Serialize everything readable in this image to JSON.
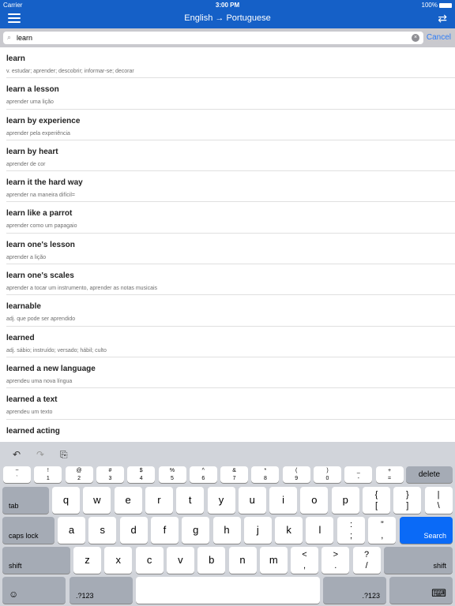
{
  "status_bar": {
    "carrier": "Carrier",
    "time": "3:00 PM",
    "battery": "100%"
  },
  "nav": {
    "title": "English → Portuguese",
    "menu_icon": "hamburger-icon",
    "swap_icon": "swap-arrows-icon",
    "swap_glyph": "⇄"
  },
  "search": {
    "value": "learn",
    "placeholder": "",
    "clear_glyph": "×",
    "search_glyph": "⌕",
    "cancel_label": "Cancel"
  },
  "results": [
    {
      "term": "learn",
      "translation": "v. estudar; aprender; descobrir; informar-se; decorar"
    },
    {
      "term": "learn a lesson",
      "translation": "aprender uma lição"
    },
    {
      "term": "learn by experience",
      "translation": "aprender pela experiência"
    },
    {
      "term": "learn by heart",
      "translation": "aprender de cor"
    },
    {
      "term": "learn it the hard way",
      "translation": "aprender na maneira difícil="
    },
    {
      "term": "learn like a parrot",
      "translation": "aprender como um papagaio"
    },
    {
      "term": "learn one's lesson",
      "translation": "aprender a lição"
    },
    {
      "term": "learn one's scales",
      "translation": "aprender a tocar um instrumento, aprender as notas musicais"
    },
    {
      "term": "learnable",
      "translation": "adj. que pode ser aprendido"
    },
    {
      "term": "learned",
      "translation": "adj. sábio; instruído; versado; hábil; culto"
    },
    {
      "term": "learned a new language",
      "translation": "aprendeu uma nova língua"
    },
    {
      "term": "learned a text",
      "translation": "aprendeu um texto"
    },
    {
      "term": "learned acting",
      "translation": ""
    }
  ],
  "keyboard": {
    "toolbar": {
      "undo": "↶",
      "redo": "↷",
      "paste": "⎘"
    },
    "number_row": [
      {
        "top": "~",
        "bot": "`"
      },
      {
        "top": "!",
        "bot": "1"
      },
      {
        "top": "@",
        "bot": "2"
      },
      {
        "top": "#",
        "bot": "3"
      },
      {
        "top": "$",
        "bot": "4"
      },
      {
        "top": "%",
        "bot": "5"
      },
      {
        "top": "^",
        "bot": "6"
      },
      {
        "top": "&",
        "bot": "7"
      },
      {
        "top": "*",
        "bot": "8"
      },
      {
        "top": "(",
        "bot": "9"
      },
      {
        "top": ")",
        "bot": "0"
      },
      {
        "top": "_",
        "bot": "-"
      },
      {
        "top": "+",
        "bot": "="
      }
    ],
    "delete": "delete",
    "tab": "tab",
    "row1": [
      "q",
      "w",
      "e",
      "r",
      "t",
      "y",
      "u",
      "i",
      "o",
      "p"
    ],
    "row1_sym": [
      {
        "top": "{",
        "bot": "["
      },
      {
        "top": "}",
        "bot": "]"
      },
      {
        "top": "|",
        "bot": "\\"
      }
    ],
    "caps": "caps lock",
    "row2": [
      "a",
      "s",
      "d",
      "f",
      "g",
      "h",
      "j",
      "k",
      "l"
    ],
    "row2_sym": [
      {
        "top": ":",
        "bot": ";"
      },
      {
        "top": "”",
        "bot": ","
      }
    ],
    "search": "Search",
    "shift": "shift",
    "row3": [
      "z",
      "x",
      "c",
      "v",
      "b",
      "n",
      "m"
    ],
    "row3_sym": [
      {
        "top": "<",
        "bot": ","
      },
      {
        "top": ">",
        "bot": "."
      },
      {
        "top": "?",
        "bot": "/"
      }
    ],
    "emoji": "☺",
    "num": ".?123",
    "hide": "⌨"
  }
}
